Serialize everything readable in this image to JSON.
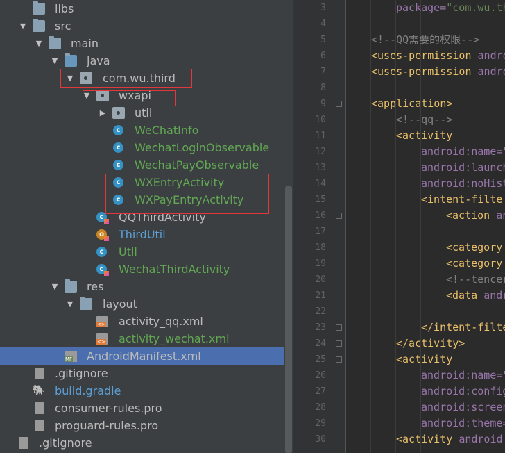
{
  "tree": {
    "items": [
      {
        "label": "libs",
        "kind": "folder",
        "color": "default"
      },
      {
        "label": "src",
        "kind": "folder",
        "color": "default"
      },
      {
        "label": "main",
        "kind": "folder",
        "color": "default"
      },
      {
        "label": "java",
        "kind": "folder-blue",
        "color": "default"
      },
      {
        "label": "com.wu.third",
        "kind": "package",
        "color": "default"
      },
      {
        "label": "wxapi",
        "kind": "package",
        "color": "default"
      },
      {
        "label": "util",
        "kind": "package",
        "color": "default"
      },
      {
        "label": "WeChatInfo",
        "kind": "class",
        "color": "green"
      },
      {
        "label": "WechatLoginObservable",
        "kind": "class",
        "color": "green"
      },
      {
        "label": "WechatPayObservable",
        "kind": "class",
        "color": "green"
      },
      {
        "label": "WXEntryActivity",
        "kind": "class",
        "color": "green"
      },
      {
        "label": "WXPayEntryActivity",
        "kind": "class",
        "color": "green"
      },
      {
        "label": "QQThirdActivity",
        "kind": "kotlin-class",
        "color": "default"
      },
      {
        "label": "ThirdUtil",
        "kind": "kotlin-object",
        "color": "blue"
      },
      {
        "label": "Util",
        "kind": "class",
        "color": "green"
      },
      {
        "label": "WechatThirdActivity",
        "kind": "kotlin-class",
        "color": "green"
      },
      {
        "label": "res",
        "kind": "res-folder",
        "color": "default"
      },
      {
        "label": "layout",
        "kind": "folder",
        "color": "default"
      },
      {
        "label": "activity_qq.xml",
        "kind": "xml",
        "color": "default"
      },
      {
        "label": "activity_wechat.xml",
        "kind": "xml",
        "color": "green"
      },
      {
        "label": "AndroidManifest.xml",
        "kind": "manifest",
        "color": "default"
      },
      {
        "label": ".gitignore",
        "kind": "file",
        "color": "default"
      },
      {
        "label": "build.gradle",
        "kind": "gradle",
        "color": "blue"
      },
      {
        "label": "consumer-rules.pro",
        "kind": "file",
        "color": "default"
      },
      {
        "label": "proguard-rules.pro",
        "kind": "file",
        "color": "default"
      },
      {
        "label": ".gitignore",
        "kind": "file",
        "color": "default"
      }
    ]
  },
  "editor": {
    "line_numbers": [
      "3",
      "4",
      "5",
      "6",
      "7",
      "8",
      "9",
      "10",
      "11",
      "12",
      "13",
      "14",
      "15",
      "16",
      "17",
      "18",
      "19",
      "20",
      "21",
      "22",
      "23",
      "24",
      "25",
      "26",
      "27",
      "28",
      "29",
      "30"
    ],
    "lines": [
      {
        "indent": 1,
        "parts": [
          [
            "attr",
            "package="
          ],
          [
            "val",
            "\"com.wu.third\""
          ]
        ]
      },
      {
        "indent": 0,
        "parts": []
      },
      {
        "indent": 0,
        "parts": [
          [
            "com",
            "<!--QQ需要的权限-->"
          ]
        ]
      },
      {
        "indent": 0,
        "parts": [
          [
            "tag",
            "<uses-permission "
          ],
          [
            "attr",
            "andro"
          ]
        ]
      },
      {
        "indent": 0,
        "parts": [
          [
            "tag",
            "<uses-permission "
          ],
          [
            "attr",
            "andro"
          ]
        ]
      },
      {
        "indent": 0,
        "parts": []
      },
      {
        "indent": 0,
        "parts": [
          [
            "tag",
            "<application>"
          ]
        ]
      },
      {
        "indent": 1,
        "parts": [
          [
            "com",
            "<!--qq-->"
          ]
        ]
      },
      {
        "indent": 1,
        "parts": [
          [
            "tag",
            "<activity"
          ]
        ]
      },
      {
        "indent": 2,
        "parts": [
          [
            "attr",
            "android:name=\""
          ]
        ]
      },
      {
        "indent": 2,
        "parts": [
          [
            "attr",
            "android:launch"
          ]
        ]
      },
      {
        "indent": 2,
        "parts": [
          [
            "attr",
            "android:noHist"
          ]
        ]
      },
      {
        "indent": 2,
        "parts": [
          [
            "tag",
            "<intent-filte"
          ]
        ]
      },
      {
        "indent": 3,
        "parts": [
          [
            "tag",
            "<action "
          ],
          [
            "attr",
            "an"
          ]
        ]
      },
      {
        "indent": 0,
        "parts": []
      },
      {
        "indent": 3,
        "parts": [
          [
            "tag",
            "<category "
          ]
        ]
      },
      {
        "indent": 3,
        "parts": [
          [
            "tag",
            "<category "
          ]
        ]
      },
      {
        "indent": 3,
        "parts": [
          [
            "com",
            "<!--tencer"
          ]
        ]
      },
      {
        "indent": 3,
        "parts": [
          [
            "tag",
            "<data "
          ],
          [
            "attr",
            "andr"
          ]
        ]
      },
      {
        "indent": 0,
        "parts": []
      },
      {
        "indent": 2,
        "parts": [
          [
            "tag",
            "</intent-filte"
          ]
        ]
      },
      {
        "indent": 1,
        "parts": [
          [
            "tag",
            "</activity>"
          ]
        ]
      },
      {
        "indent": 1,
        "parts": [
          [
            "tag",
            "<activity"
          ]
        ]
      },
      {
        "indent": 2,
        "parts": [
          [
            "attr",
            "android:name=\""
          ]
        ]
      },
      {
        "indent": 2,
        "parts": [
          [
            "attr",
            "android:config"
          ]
        ]
      },
      {
        "indent": 2,
        "parts": [
          [
            "attr",
            "android:screen"
          ]
        ]
      },
      {
        "indent": 2,
        "parts": [
          [
            "attr",
            "android:theme="
          ]
        ]
      },
      {
        "indent": 1,
        "parts": [
          [
            "tag",
            "<activity "
          ],
          [
            "attr",
            "android:"
          ]
        ]
      }
    ]
  }
}
